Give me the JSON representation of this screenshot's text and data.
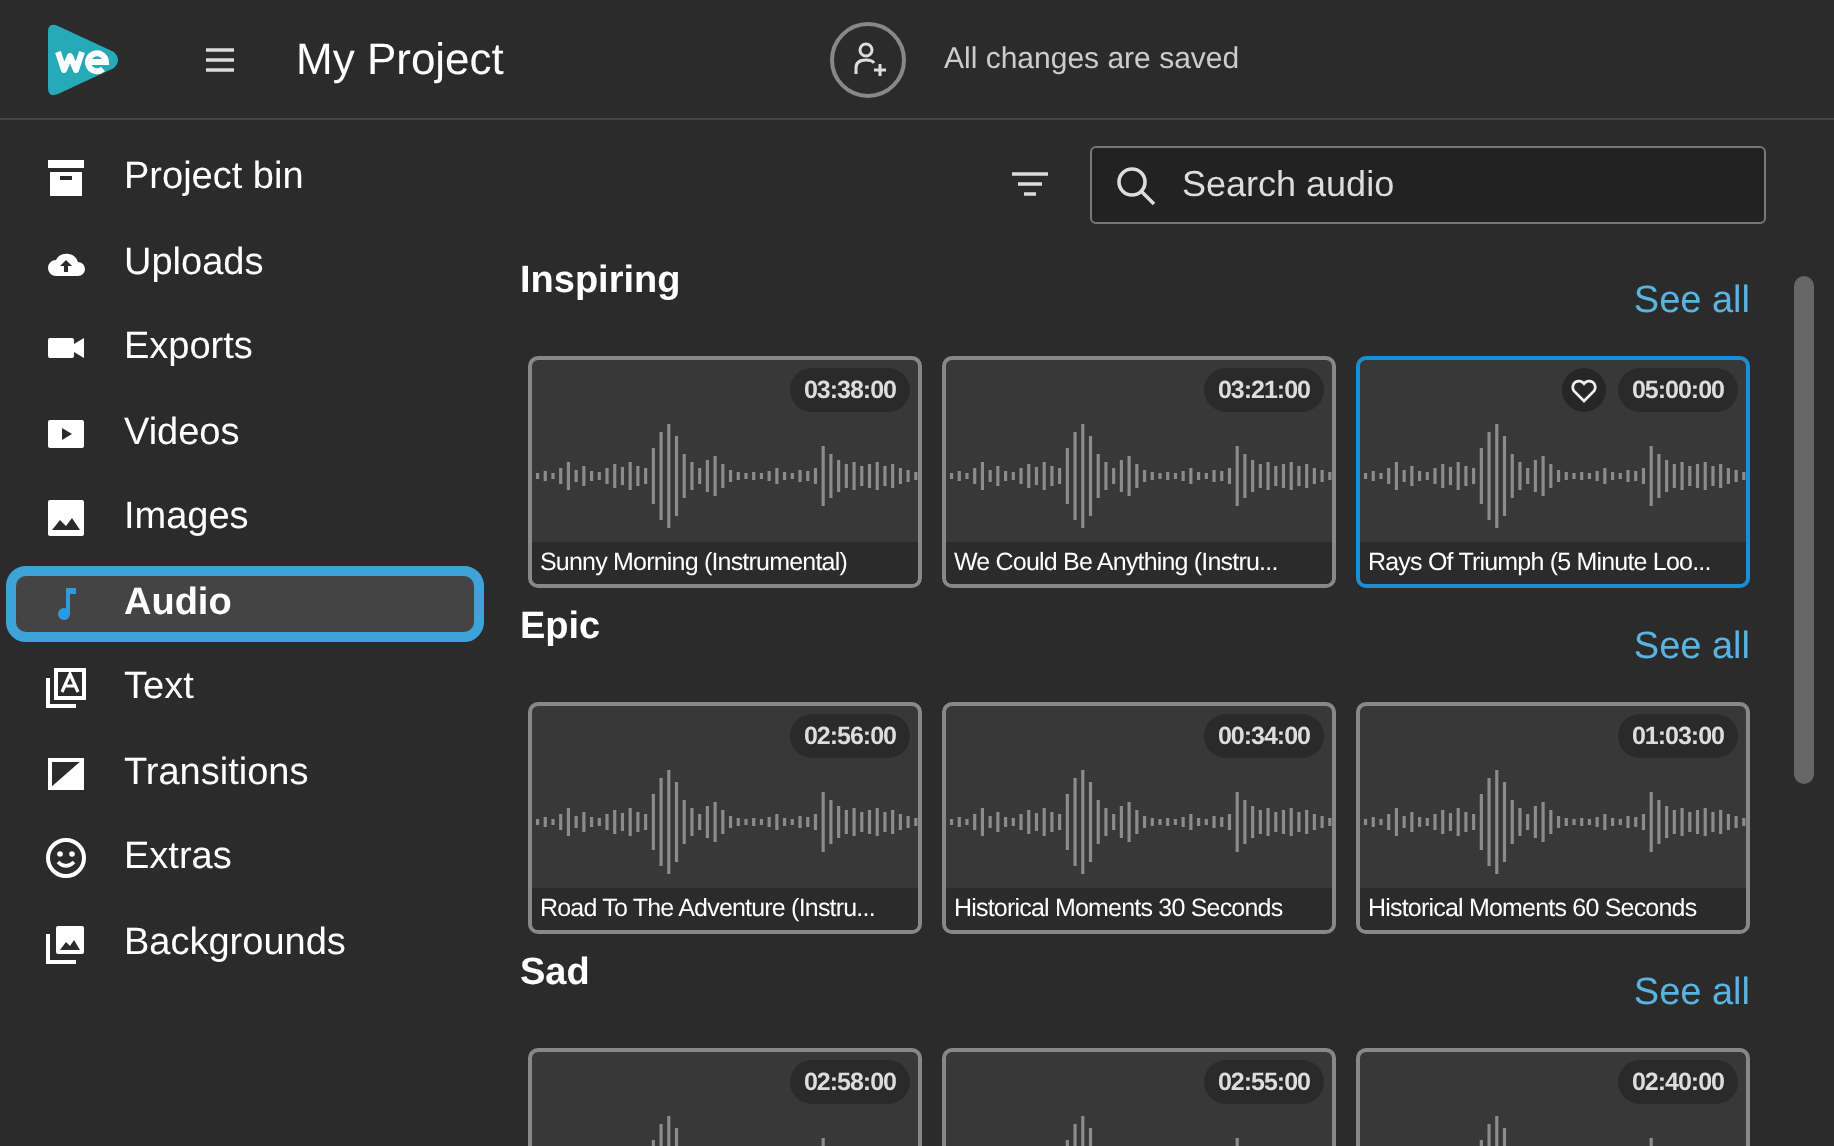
{
  "header": {
    "title": "My Project",
    "save_status": "All changes are saved"
  },
  "sidebar": {
    "items": [
      {
        "label": "Project bin",
        "selected": false
      },
      {
        "label": "Uploads",
        "selected": false
      },
      {
        "label": "Exports",
        "selected": false
      },
      {
        "label": "Videos",
        "selected": false
      },
      {
        "label": "Images",
        "selected": false
      },
      {
        "label": "Audio",
        "selected": true
      },
      {
        "label": "Text",
        "selected": false
      },
      {
        "label": "Transitions",
        "selected": false
      },
      {
        "label": "Extras",
        "selected": false
      },
      {
        "label": "Backgrounds",
        "selected": false
      }
    ]
  },
  "search": {
    "placeholder": "Search audio"
  },
  "sections": [
    {
      "heading": "Inspiring",
      "see_all": "See all",
      "cards": [
        {
          "duration": "03:38:00",
          "title": "Sunny Morning (Instrumental)",
          "selected": false
        },
        {
          "duration": "03:21:00",
          "title": "We Could Be Anything (Instru...",
          "selected": false
        },
        {
          "duration": "05:00:00",
          "title": "Rays Of Triumph (5 Minute Loo...",
          "selected": true
        }
      ]
    },
    {
      "heading": "Epic",
      "see_all": "See all",
      "cards": [
        {
          "duration": "02:56:00",
          "title": "Road To The Adventure (Instru...",
          "selected": false
        },
        {
          "duration": "00:34:00",
          "title": "Historical Moments 30 Seconds",
          "selected": false
        },
        {
          "duration": "01:03:00",
          "title": "Historical Moments 60 Seconds",
          "selected": false
        }
      ]
    },
    {
      "heading": "Sad",
      "see_all": "See all",
      "cards": [
        {
          "duration": "02:58:00",
          "selected": false
        },
        {
          "duration": "02:55:00",
          "selected": false
        },
        {
          "duration": "02:40:00",
          "selected": false
        }
      ]
    }
  ]
}
